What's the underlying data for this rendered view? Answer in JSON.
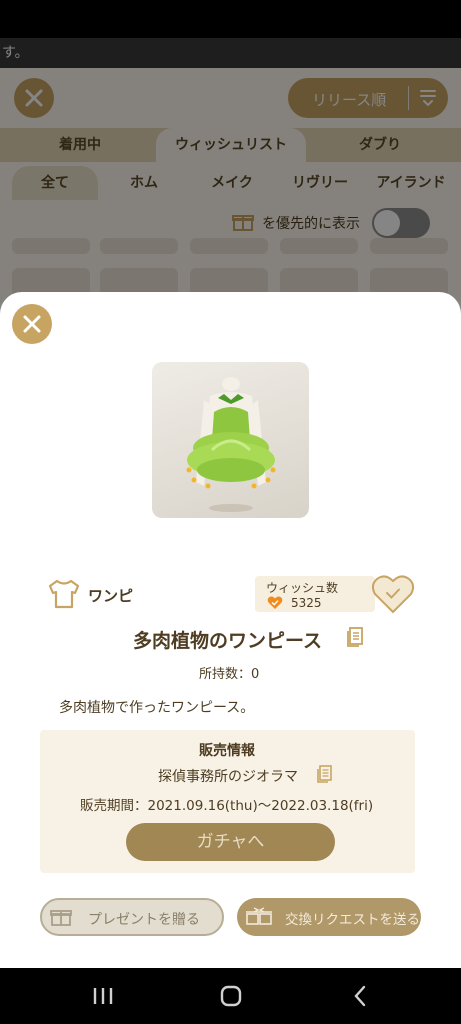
{
  "toast": {
    "text": "す。"
  },
  "header": {
    "sort_label": "リリース順"
  },
  "tabs": [
    {
      "label": "着用中"
    },
    {
      "label": "ウィッシュリスト"
    },
    {
      "label": "ダブり"
    }
  ],
  "categories": [
    {
      "label": "全て"
    },
    {
      "label": "ホム"
    },
    {
      "label": "メイク"
    },
    {
      "label": "リヴリー"
    },
    {
      "label": "アイランド"
    }
  ],
  "priority": {
    "label": "を優先的に表示",
    "toggle_on": false
  },
  "item": {
    "type_label": "ワンピ",
    "wish_label": "ウィッシュ数",
    "wish_count": "5325",
    "name": "多肉植物のワンピース",
    "owned": "所持数：0",
    "description": "多肉植物で作ったワンピース。"
  },
  "sale": {
    "title": "販売情報",
    "source": "探偵事務所のジオラマ",
    "period": "販売期間：2021.09.16(thu)〜2022.03.18(fri)",
    "gacha_button": "ガチャへ"
  },
  "actions": {
    "present": "プレゼントを贈る",
    "trade": "交換リクエストを送る"
  },
  "colors": {
    "accent": "#c8a463",
    "text": "#4e3d22",
    "panel": "#f8f2e6"
  }
}
